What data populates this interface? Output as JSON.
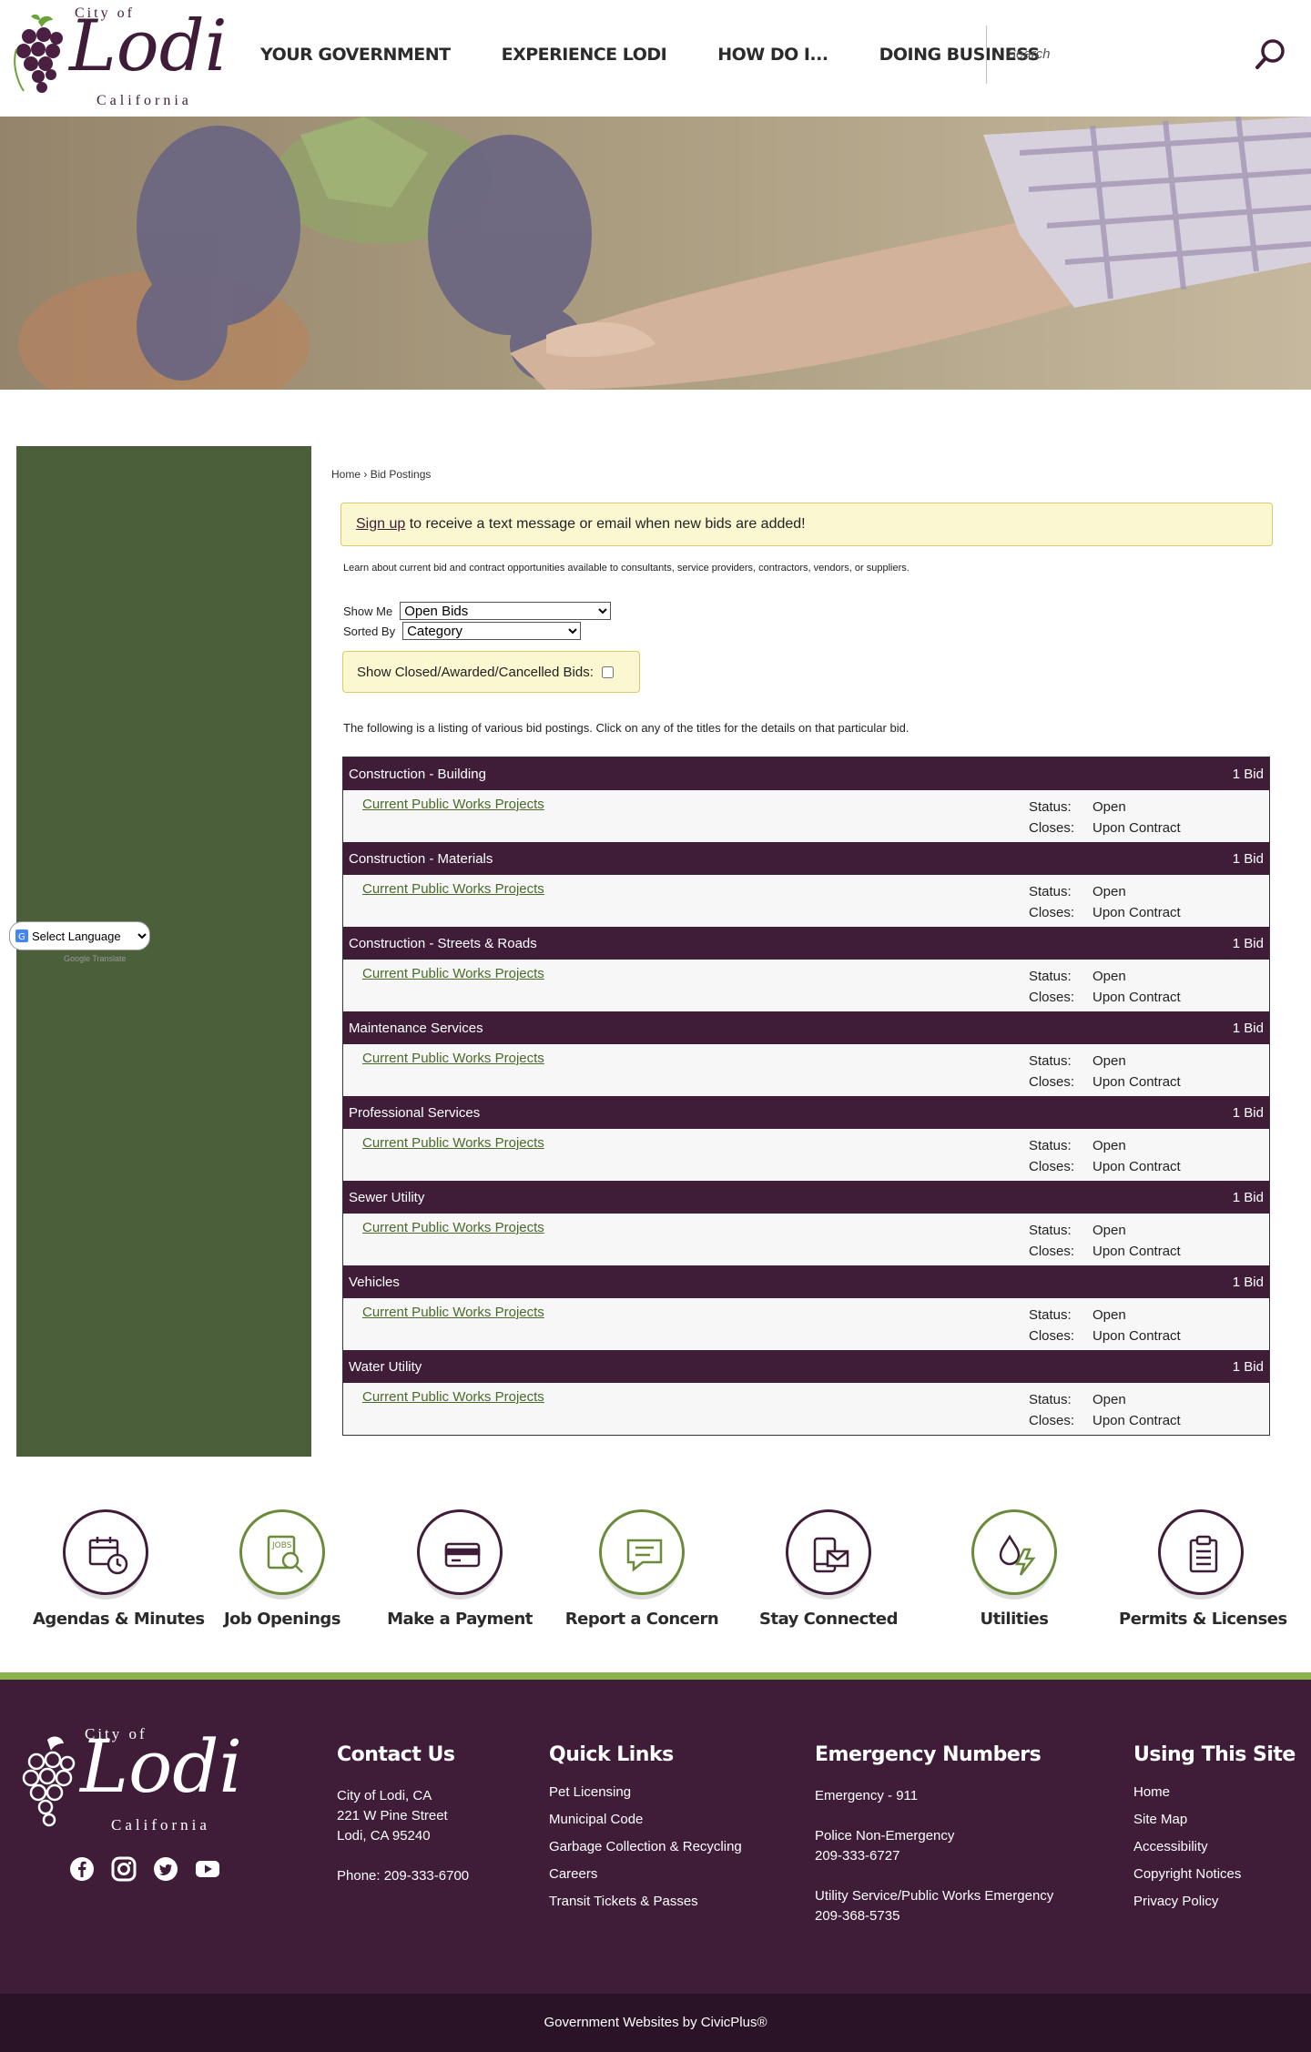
{
  "header": {
    "logo": {
      "city_of": "City of",
      "name": "Lodi",
      "state": "California"
    },
    "nav": [
      "YOUR GOVERNMENT",
      "EXPERIENCE LODI",
      "HOW DO I...",
      "DOING BUSINESS"
    ],
    "search": {
      "placeholder": "Search"
    }
  },
  "sidebar": {
    "translate": {
      "label": "Select Language",
      "powered_by": "Google Translate"
    }
  },
  "breadcrumb": {
    "home": "Home",
    "separator": "›",
    "current": "Bid Postings"
  },
  "signup": {
    "link": "Sign up",
    "text": " to receive a text message or email when new bids are added!"
  },
  "intro": "Learn about current bid and contract opportunities available to consultants, service providers, contractors, vendors, or suppliers.",
  "filters": {
    "show_me_label": "Show Me",
    "show_me_value": "Open Bids",
    "sorted_by_label": "Sorted By",
    "sorted_by_value": "Category",
    "closed_label": "Show Closed/Awarded/Cancelled Bids:"
  },
  "listing_text": "The following is a listing of various bid postings. Click on any of the titles for the details on that particular bid.",
  "bid_labels": {
    "status": "Status:",
    "closes": "Closes:"
  },
  "categories": [
    {
      "name": "Construction - Building",
      "count": "1 Bid",
      "bid": {
        "title": "Current Public Works Projects",
        "status": "Open",
        "closes": "Upon Contract"
      }
    },
    {
      "name": "Construction - Materials",
      "count": "1 Bid",
      "bid": {
        "title": "Current Public Works Projects",
        "status": "Open",
        "closes": "Upon Contract"
      }
    },
    {
      "name": "Construction - Streets & Roads",
      "count": "1 Bid",
      "bid": {
        "title": "Current Public Works Projects",
        "status": "Open",
        "closes": "Upon Contract"
      }
    },
    {
      "name": "Maintenance Services",
      "count": "1 Bid",
      "bid": {
        "title": "Current Public Works Projects",
        "status": "Open",
        "closes": "Upon Contract"
      }
    },
    {
      "name": "Professional Services",
      "count": "1 Bid",
      "bid": {
        "title": "Current Public Works Projects",
        "status": "Open",
        "closes": "Upon Contract"
      }
    },
    {
      "name": "Sewer Utility",
      "count": "1 Bid",
      "bid": {
        "title": "Current Public Works Projects",
        "status": "Open",
        "closes": "Upon Contract"
      }
    },
    {
      "name": "Vehicles",
      "count": "1 Bid",
      "bid": {
        "title": "Current Public Works Projects",
        "status": "Open",
        "closes": "Upon Contract"
      }
    },
    {
      "name": "Water Utility",
      "count": "1 Bid",
      "bid": {
        "title": "Current Public Works Projects",
        "status": "Open",
        "closes": "Upon Contract"
      }
    }
  ],
  "quick_links": [
    {
      "label": "Agendas & Minutes",
      "icon": "calendar-clock-icon",
      "style": "purple"
    },
    {
      "label": "Job Openings",
      "icon": "jobs-search-icon",
      "style": "green"
    },
    {
      "label": "Make a Payment",
      "icon": "credit-card-icon",
      "style": "purple"
    },
    {
      "label": "Report a Concern",
      "icon": "chat-bubble-icon",
      "style": "green"
    },
    {
      "label": "Stay Connected",
      "icon": "phone-mail-icon",
      "style": "purple"
    },
    {
      "label": "Utilities",
      "icon": "water-power-icon",
      "style": "green"
    },
    {
      "label": "Permits & Licenses",
      "icon": "clipboard-icon",
      "style": "purple"
    }
  ],
  "footer": {
    "logo": {
      "city_of": "City of",
      "name": "Lodi",
      "state": "California"
    },
    "social": [
      "facebook-icon",
      "instagram-icon",
      "twitter-icon",
      "youtube-icon"
    ],
    "contact": {
      "heading": "Contact Us",
      "line1": "City of Lodi, CA",
      "line2": "221 W Pine Street",
      "line3": "Lodi, CA 95240",
      "phone": "Phone: 209-333-6700"
    },
    "quick_links": {
      "heading": "Quick Links",
      "items": [
        "Pet Licensing",
        "Municipal Code",
        "Garbage Collection & Recycling",
        "Careers",
        "Transit Tickets & Passes"
      ]
    },
    "emergency": {
      "heading": "Emergency Numbers",
      "e1": "Emergency - 911",
      "e2_label": "Police Non-Emergency",
      "e2_number": "209-333-6727",
      "e3_label": "Utility Service/Public Works Emergency",
      "e3_number": "209-368-5735"
    },
    "using_site": {
      "heading": "Using This Site",
      "items": [
        "Home",
        "Site Map",
        "Accessibility",
        "Copyright Notices",
        "Privacy Policy"
      ]
    },
    "credit": "Government Websites by CivicPlus®"
  },
  "colors": {
    "brand_purple": "#3f1d38",
    "sidebar_green": "#4a5f3a",
    "accent_green": "#8ab34a",
    "link_green": "#4a6a2a",
    "notice_yellow": "#fbf7d0"
  }
}
